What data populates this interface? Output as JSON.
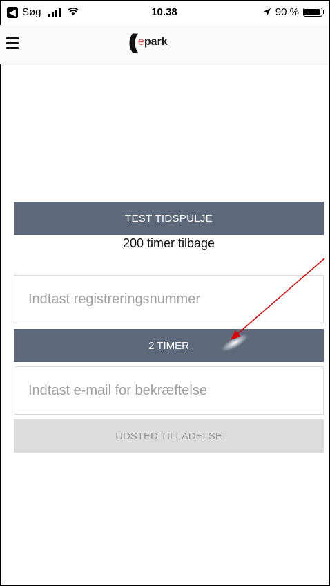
{
  "status_bar": {
    "back_app": "Søg",
    "time": "10.38",
    "battery": "90 %",
    "battery_level": 0.9,
    "icons": [
      "back-badge-icon",
      "signal-icon",
      "wifi-icon",
      "location-arrow-icon",
      "battery-icon"
    ]
  },
  "nav": {
    "menu_icon": "hamburger-menu-icon",
    "logo": {
      "prefix": "e",
      "text": "park"
    }
  },
  "main": {
    "pool_title": "TEST TIDSPULJE",
    "remaining": "200 timer tilbage",
    "registration": {
      "placeholder": "Indtast registreringsnummer",
      "value": ""
    },
    "duration_label": "2 TIMER",
    "email": {
      "placeholder": "Indtast e-mail for bekræftelse",
      "value": ""
    },
    "issue_label": "UDSTED TILLADELSE"
  },
  "colors": {
    "banner": "#5e6a7c",
    "disabled_button": "#dcdcdc",
    "annotation_arrow": "#e00000",
    "logo_accent": "#d9534f"
  }
}
